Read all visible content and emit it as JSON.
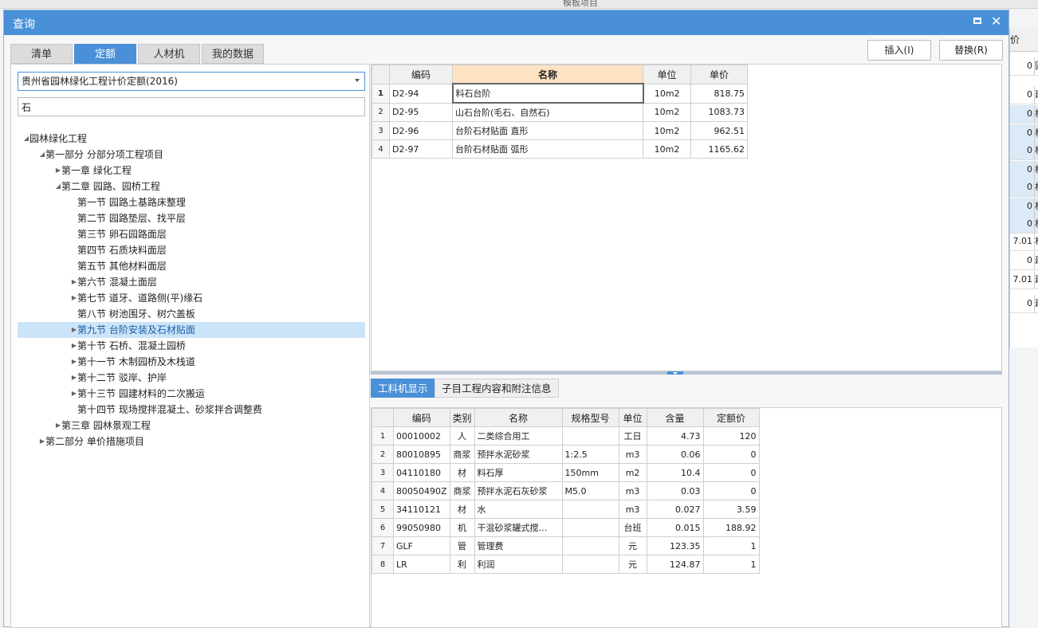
{
  "background": {
    "top_title": "模板项目",
    "right_header": "价",
    "right_rows": [
      {
        "value": "0",
        "tail": "固",
        "hl": false
      },
      {
        "value": "0",
        "tail": "建",
        "hl": false
      },
      {
        "value": "0",
        "tail": "机",
        "hl": true
      },
      {
        "value": "0",
        "tail": "机",
        "hl": true
      },
      {
        "value": "0",
        "tail": "机",
        "hl": true
      },
      {
        "value": "0",
        "tail": "机",
        "hl": true
      },
      {
        "value": "0",
        "tail": "机",
        "hl": true
      },
      {
        "value": "0",
        "tail": "机",
        "hl": true
      },
      {
        "value": "0",
        "tail": "机",
        "hl": true
      },
      {
        "value": "7.01",
        "tail": "机",
        "hl": false
      },
      {
        "value": "0",
        "tail": "建",
        "hl": false
      },
      {
        "value": "7.01",
        "tail": "建",
        "hl": false
      },
      {
        "value": "0",
        "tail": "建",
        "hl": false
      }
    ]
  },
  "dialog": {
    "title": "查询",
    "maximize_icon": "maximize-icon",
    "close_icon": "close-icon",
    "close_glyph": "✕"
  },
  "tabs": [
    {
      "label": "清单",
      "active": false
    },
    {
      "label": "定额",
      "active": true
    },
    {
      "label": "人材机",
      "active": false
    },
    {
      "label": "我的数据",
      "active": false
    }
  ],
  "buttons": {
    "insert": "插入(I)",
    "replace": "替换(R)"
  },
  "library": {
    "selected": "贵州省园林绿化工程计价定额(2016)"
  },
  "search": {
    "value": "石"
  },
  "tree": [
    {
      "label": "园林绿化工程",
      "level": 0,
      "toggle": "open"
    },
    {
      "label": "第一部分 分部分项工程项目",
      "level": 1,
      "toggle": "open"
    },
    {
      "label": "第一章 绿化工程",
      "level": 2,
      "toggle": "closed"
    },
    {
      "label": "第二章 园路、园桥工程",
      "level": 2,
      "toggle": "open"
    },
    {
      "label": "第一节 园路土基路床整理",
      "level": 3,
      "toggle": "none"
    },
    {
      "label": "第二节 园路垫层、找平层",
      "level": 3,
      "toggle": "none"
    },
    {
      "label": "第三节 卵石园路面层",
      "level": 3,
      "toggle": "none"
    },
    {
      "label": "第四节 石质块料面层",
      "level": 3,
      "toggle": "none"
    },
    {
      "label": "第五节 其他材料面层",
      "level": 3,
      "toggle": "none"
    },
    {
      "label": "第六节 混凝土面层",
      "level": 3,
      "toggle": "closed"
    },
    {
      "label": "第七节 道牙、道路侧(平)缘石",
      "level": 3,
      "toggle": "closed"
    },
    {
      "label": "第八节 树池围牙、树穴盖板",
      "level": 3,
      "toggle": "none"
    },
    {
      "label": "第九节 台阶安装及石材贴面",
      "level": 3,
      "toggle": "closed",
      "selected": true
    },
    {
      "label": "第十节 石桥、混凝土园桥",
      "level": 3,
      "toggle": "closed"
    },
    {
      "label": "第十一节 木制园桥及木栈道",
      "level": 3,
      "toggle": "closed"
    },
    {
      "label": "第十二节 驳岸、护岸",
      "level": 3,
      "toggle": "closed"
    },
    {
      "label": "第十三节 园建材料的二次搬运",
      "level": 3,
      "toggle": "closed"
    },
    {
      "label": "第十四节 现场搅拌混凝土、砂浆拌合调整费",
      "level": 3,
      "toggle": "none"
    },
    {
      "label": "第三章 园林景观工程",
      "level": 2,
      "toggle": "closed"
    },
    {
      "label": "第二部分 单价措施项目",
      "level": 1,
      "toggle": "closed"
    }
  ],
  "quota_table": {
    "headers": [
      "",
      "编码",
      "名称",
      "单位",
      "单价"
    ],
    "rows": [
      {
        "idx": "1",
        "code": "D2-94",
        "name": "料石台阶",
        "unit": "10m2",
        "price": "818.75"
      },
      {
        "idx": "2",
        "code": "D2-95",
        "name": "山石台阶(毛石、自然石)",
        "unit": "10m2",
        "price": "1083.73"
      },
      {
        "idx": "3",
        "code": "D2-96",
        "name": "台阶石材贴面 直形",
        "unit": "10m2",
        "price": "962.51"
      },
      {
        "idx": "4",
        "code": "D2-97",
        "name": "台阶石材贴面 弧形",
        "unit": "10m2",
        "price": "1165.62"
      }
    ]
  },
  "bottom_tabs": [
    {
      "label": "工料机显示",
      "active": true
    },
    {
      "label": "子目工程内容和附注信息",
      "active": false
    }
  ],
  "resource_table": {
    "headers": [
      "",
      "编码",
      "类别",
      "名称",
      "规格型号",
      "单位",
      "含量",
      "定额价"
    ],
    "rows": [
      {
        "idx": "1",
        "code": "00010002",
        "type": "人",
        "name": "二类综合用工",
        "spec": "",
        "unit": "工日",
        "qty": "4.73",
        "price": "120"
      },
      {
        "idx": "2",
        "code": "80010895",
        "type": "商浆",
        "name": "预拌水泥砂浆",
        "spec": "1:2.5",
        "unit": "m3",
        "qty": "0.06",
        "price": "0"
      },
      {
        "idx": "3",
        "code": "04110180",
        "type": "材",
        "name": "料石厚",
        "spec": "150mm",
        "unit": "m2",
        "qty": "10.4",
        "price": "0"
      },
      {
        "idx": "4",
        "code": "80050490Z",
        "type": "商浆",
        "name": "预拌水泥石灰砂浆",
        "spec": "M5.0",
        "unit": "m3",
        "qty": "0.03",
        "price": "0"
      },
      {
        "idx": "5",
        "code": "34110121",
        "type": "材",
        "name": "水",
        "spec": "",
        "unit": "m3",
        "qty": "0.027",
        "price": "3.59"
      },
      {
        "idx": "6",
        "code": "99050980",
        "type": "机",
        "name": "干混砂浆罐式搅…",
        "spec": "",
        "unit": "台班",
        "qty": "0.015",
        "price": "188.92"
      },
      {
        "idx": "7",
        "code": "GLF",
        "type": "管",
        "name": "管理费",
        "spec": "",
        "unit": "元",
        "qty": "123.35",
        "price": "1"
      },
      {
        "idx": "8",
        "code": "LR",
        "type": "利",
        "name": "利润",
        "spec": "",
        "unit": "元",
        "qty": "124.87",
        "price": "1"
      }
    ]
  }
}
